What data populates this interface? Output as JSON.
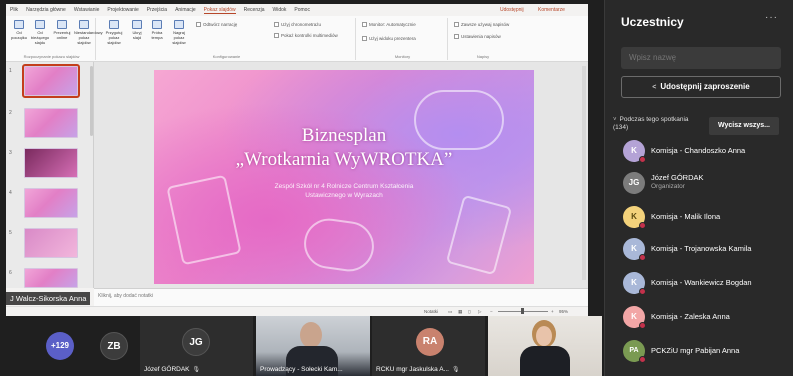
{
  "ppt": {
    "tabs": [
      "Plik",
      "Narzędzia główne",
      "Wstawianie",
      "Projektowanie",
      "Przejścia",
      "Animacje",
      "Pokaz slajdów",
      "Recenzja",
      "Widok",
      "Pomoc"
    ],
    "active_tab": "Pokaz slajdów",
    "share_label": "Udostępnij",
    "comments_label": "Komentarze",
    "ribbon": {
      "start_group": "Rozpoczynanie pokazu slajdów",
      "start_buttons": [
        "Od początku",
        "Od bieżącego slajdu",
        "Prezentuj online",
        "Niestandardowy pokaz slajdów"
      ],
      "setup_group": "Konfigurowanie",
      "setup_buttons": [
        "Przygotuj pokaz slajdów",
        "Ukryj slajd",
        "Próba tempa",
        "Nagraj pokaz slajdów"
      ],
      "setup_checks": [
        "Odtwórz narrację",
        "Użyj chronometrażu",
        "Pokaż kontrolki multimediów"
      ],
      "monitors_group": "Monitory",
      "monitor_label": "Monitor: Automatycznie",
      "presenter_view": "Użyj widoku prezentera",
      "captions_group": "Napisy",
      "captions": [
        "Zawsze używaj napisów",
        "Ustawienia napisów"
      ]
    },
    "slide_numbers": [
      "1",
      "2",
      "3",
      "4",
      "5",
      "6"
    ],
    "slide": {
      "title_line1": "Biznesplan",
      "title_line2": "„Wrotkarnia WyWROTKA”",
      "subtitle_line1": "Zespół Szkół nr 4 Rolnicze Centrum Kształcenia",
      "subtitle_line2": "Ustawicznego w Wyrazach"
    },
    "notes_placeholder": "Kliknij, aby dodać notatki",
    "status_notes": "Notatki",
    "zoom": "95%"
  },
  "presenter_label": "J Walcz-Sikorska Anna",
  "panel": {
    "title": "Uczestnicy",
    "more": "···",
    "search_placeholder": "Wpisz nazwę",
    "share_button": "Udostępnij zaproszenie",
    "during_label": "Podczas tego spotkania",
    "during_count": "(134)",
    "mute_all": "Wycisz wszys...",
    "participants": [
      {
        "initials": "K",
        "name": "Komisja - Chandoszko Anna",
        "color": "#b4a3d6",
        "role": "",
        "muted": true
      },
      {
        "initials": "JG",
        "name": "Józef GÓRDAK",
        "color": "#7c7c7c",
        "role": "Organizator",
        "muted": false
      },
      {
        "initials": "K",
        "name": "Komisja - Malik Ilona",
        "color": "#f3d27b",
        "role": "",
        "muted": true
      },
      {
        "initials": "K",
        "name": "Komisja - Trojanowska Kamila",
        "color": "#a9b8d8",
        "role": "",
        "muted": true
      },
      {
        "initials": "K",
        "name": "Komisja - Wankiewicz Bogdan",
        "color": "#a9b8d8",
        "role": "",
        "muted": true
      },
      {
        "initials": "K",
        "name": "Komisja - Zaleska Anna",
        "color": "#f2a6a6",
        "role": "",
        "muted": true
      },
      {
        "initials": "PA",
        "name": "PCKZiU mgr Pabijan Anna",
        "color": "#7a9a52",
        "role": "",
        "muted": true
      }
    ]
  },
  "strip": {
    "overflow": "+129",
    "tiles": [
      {
        "initials": "ZB",
        "label": "",
        "color": "#3c3c3c"
      },
      {
        "initials": "JG",
        "label": "Józef GÓRDAK",
        "color": "#3c3c3c"
      },
      {
        "initials": "",
        "label": "Prowadzący - Sołecki Kam...",
        "color": ""
      },
      {
        "initials": "RA",
        "label": "RCKU mgr Jaskulska A...",
        "color": "#c9826e"
      },
      {
        "initials": "",
        "label": "",
        "color": ""
      }
    ]
  },
  "colors": {
    "accent": "#b7472a",
    "panel_bg": "#292929",
    "muted_indicator": "#c4314b",
    "overflow_badge": "#5b5fc7"
  }
}
